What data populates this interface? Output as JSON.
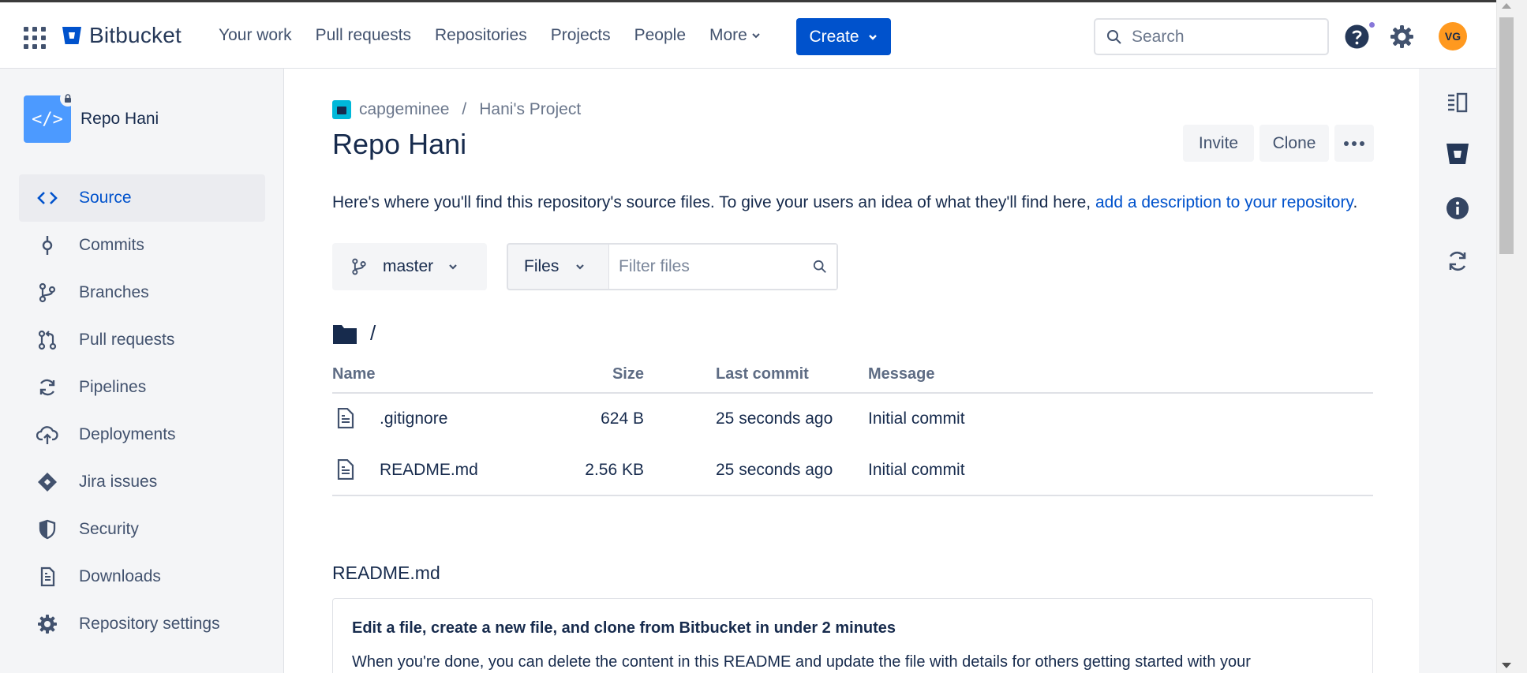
{
  "topbar": {
    "app_name": "Bitbucket",
    "nav": [
      "Your work",
      "Pull requests",
      "Repositories",
      "Projects",
      "People",
      "More"
    ],
    "create_label": "Create",
    "search_placeholder": "Search",
    "avatar_initials": "VG",
    "brand_color": "#0052cc"
  },
  "sidebar": {
    "repo_name": "Repo Hani",
    "items": [
      {
        "label": "Source",
        "icon": "code-icon",
        "active": true
      },
      {
        "label": "Commits",
        "icon": "commit-icon"
      },
      {
        "label": "Branches",
        "icon": "branch-icon"
      },
      {
        "label": "Pull requests",
        "icon": "pull-request-icon"
      },
      {
        "label": "Pipelines",
        "icon": "pipelines-icon"
      },
      {
        "label": "Deployments",
        "icon": "cloud-upload-icon"
      },
      {
        "label": "Jira issues",
        "icon": "jira-icon"
      },
      {
        "label": "Security",
        "icon": "shield-icon"
      },
      {
        "label": "Downloads",
        "icon": "document-icon"
      },
      {
        "label": "Repository settings",
        "icon": "gear-icon"
      }
    ]
  },
  "main": {
    "breadcrumb": {
      "workspace": "capgeminee",
      "separator": "/",
      "project": "Hani's Project"
    },
    "title": "Repo Hani",
    "invite_label": "Invite",
    "clone_label": "Clone",
    "description_text": "Here's where you'll find this repository's source files. To give your users an idea of what they'll find here,",
    "description_link": "add a description to your repository",
    "description_end": ".",
    "branch": "master",
    "files_dropdown": "Files",
    "filter_placeholder": "Filter files",
    "path": "/",
    "table": {
      "headers": {
        "name": "Name",
        "size": "Size",
        "last_commit": "Last commit",
        "message": "Message"
      },
      "rows": [
        {
          "name": ".gitignore",
          "size": "624 B",
          "last_commit": "25 seconds ago",
          "message": "Initial commit"
        },
        {
          "name": "README.md",
          "size": "2.56 KB",
          "last_commit": "25 seconds ago",
          "message": "Initial commit"
        }
      ]
    },
    "readme": {
      "filename": "README.md",
      "heading": "Edit a file, create a new file, and clone from Bitbucket in under 2 minutes",
      "text": "When you're done, you can delete the content in this README and update the file with details for others getting started with your"
    }
  }
}
